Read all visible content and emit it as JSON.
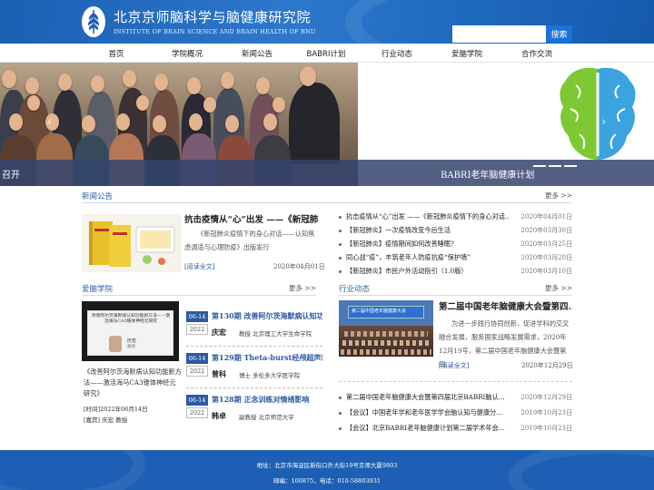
{
  "header": {
    "title_cn": "北京京师脑科学与脑健康研究院",
    "title_en": "INSTITUTE OF BRAIN SCIENCE AND BRAIN HEALTH OF BNU",
    "search_placeholder": "",
    "search_label": "搜索"
  },
  "nav": [
    "首页",
    "学院概况",
    "新闻公告",
    "BABRI计划",
    "行业动态",
    "爱脑学院",
    "合作交流"
  ],
  "banner": {
    "caption_left": "召开",
    "caption_right": "BABRI老年脑健康计划",
    "prev_icon": "‹",
    "next_icon": "›"
  },
  "news": {
    "title": "新闻公告",
    "more": "更多 >>",
    "featured": {
      "title": "抗击疫情从“心”出发 ——《新冠肺...",
      "text": "《新冠肺炎疫情下的身心对话——认知焦虑调适与心理防疫》出版发行",
      "read_more": "[阅读全文]",
      "date": "2020年04月01日"
    },
    "items": [
      {
        "title": "抗击疫情从“心”出发 ——《新冠肺炎疫情下的身心对话...",
        "date": "2020年04月01日"
      },
      {
        "title": "【新冠肺炎】一次疫情改变今后生活",
        "date": "2020年03月30日"
      },
      {
        "title": "【新冠肺炎】疫情期间如何改善睡眠?",
        "date": "2020年03月25日"
      },
      {
        "title": "同心战“疫”，丰筑老年人防疫抗疫“保护墙”",
        "date": "2020年03月20日"
      },
      {
        "title": "【新冠肺炎】市民户外活动指引（1.0版）",
        "date": "2020年03月10日"
      }
    ]
  },
  "academy": {
    "title": "爱脑学院",
    "more": "更多 >>",
    "video_text": "改善阿尔茨海默病认知功能新方法——激活海马CA3锥体神经元研究",
    "video_speaker_name": "庆宏",
    "video_speaker_sub": "教授",
    "featured_title": "《改善阿尔茨海默病认知功能新方法——激活海马CA3锥体神经元研究》",
    "time_label": "[时间]",
    "time_value": "2022年06月14日",
    "speaker_label": "[嘉宾]",
    "speaker_value": "庆宏 教授",
    "courses": [
      {
        "badge": "06-14",
        "year": "2022",
        "title": "第130期 改善阿尔茨海默病认知功...",
        "name": "庆宏",
        "desc": "教授 北京理工大学生命学院"
      },
      {
        "badge": "06-14",
        "year": "2022",
        "title": "第129期 Theta-burst经颅超声刺激...",
        "name": "曾科",
        "desc": "博士 多伦多大学医学院"
      },
      {
        "badge": "06-14",
        "year": "2022",
        "title": "第128期 正念训练对情绪影响",
        "name": "韩卓",
        "desc": "副教授 北京师范大学"
      }
    ]
  },
  "industry": {
    "title": "行业动态",
    "more": "更多 >>",
    "featured": {
      "title": "第二届中国老年脑健康大会暨第四...",
      "text": "为进一步践行协同创新，促进学科的交叉融合发展，服务国家战略发展需求，2020年12月19号，第二届中国老年脑健康大会暨第四...",
      "read_more": "[阅读全文]",
      "date": "2020年12月29日"
    },
    "stage_banner": "第二届中国老年脑健康大会",
    "items": [
      {
        "title": "第二届中国老年脑健康大会暨第四届北京BABRI脑认...",
        "date": "2020年12月29日"
      },
      {
        "title": "【会议】中国老年学和老年医学学会脑认知与健康分...",
        "date": "2019年10月23日"
      },
      {
        "title": "【会议】北京BABRI老年脑健康计划第二届学术年会...",
        "date": "2019年10月23日"
      }
    ]
  },
  "footer": {
    "address": "地址：北京市海淀区新街口外大街19号京师大厦9803",
    "contact": "邮编：100875，电话：010-58803931"
  },
  "colors": {
    "primary": "#1c5fb4",
    "accent": "#2962a8",
    "brain_green": "#7ec832",
    "brain_blue": "#3aa3e0"
  }
}
